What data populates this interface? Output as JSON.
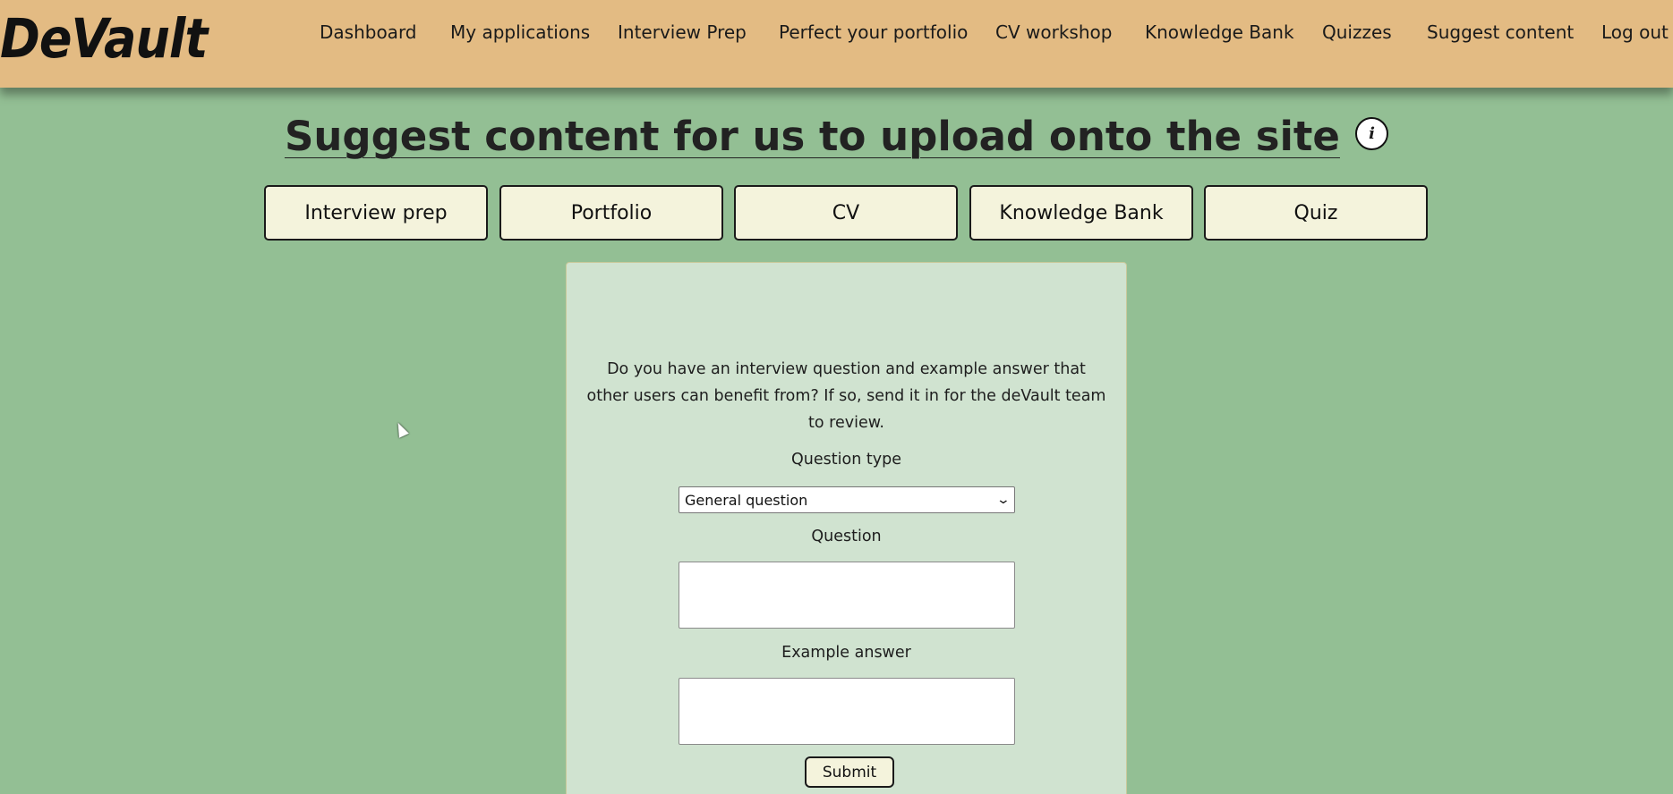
{
  "header": {
    "logo": "DeVault",
    "nav": [
      "Dashboard",
      "My applications",
      "Interview Prep",
      "Perfect your portfolio",
      "CV workshop",
      "Knowledge Bank",
      "Quizzes",
      "Suggest content",
      "Log out"
    ]
  },
  "main": {
    "title": "Suggest content for us to upload onto the site",
    "info_icon": "i",
    "tabs": [
      "Interview prep",
      "Portfolio",
      "CV",
      "Knowledge Bank",
      "Quiz"
    ]
  },
  "form": {
    "intro": "Do you have an interview question and example answer that other users can benefit from? If so, send it in for the deVault team to review.",
    "question_type_label": "Question type",
    "question_type_value": "General question",
    "question_label": "Question",
    "question_value": "",
    "answer_label": "Example answer",
    "answer_value": "",
    "submit_label": "Submit"
  },
  "colors": {
    "background": "#93bf94",
    "header": "#e3bb83",
    "card": "#d0e3d0",
    "button": "#f4f3dc"
  },
  "icons": {
    "info": "info-icon",
    "select": "chevron-down-icon",
    "cursor": "mouse-pointer-icon"
  }
}
